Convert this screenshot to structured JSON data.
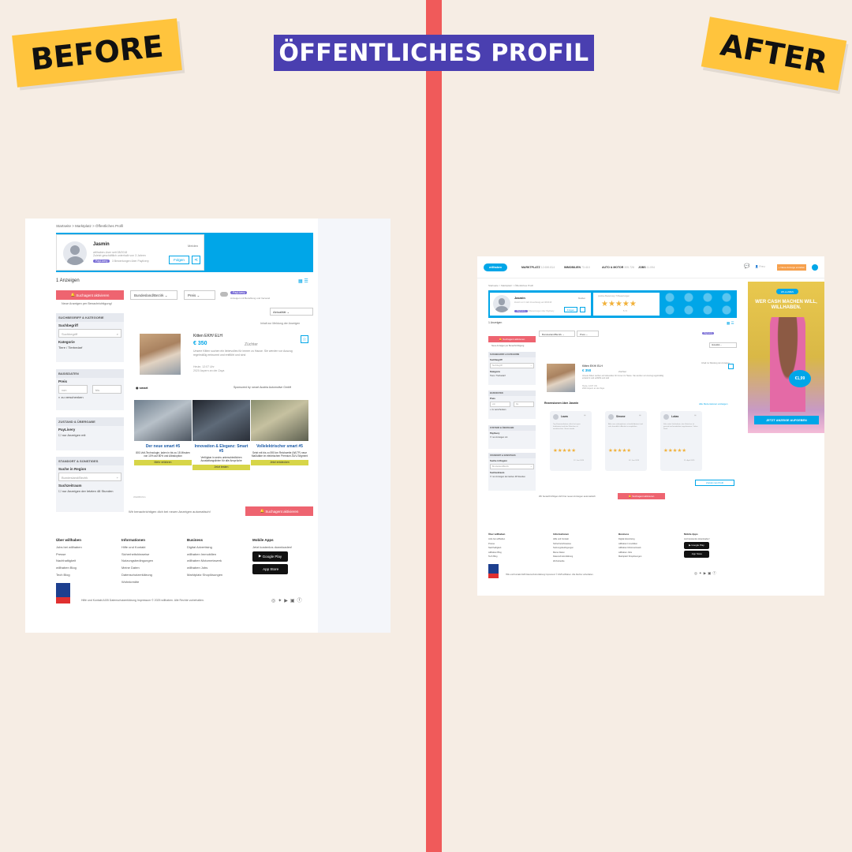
{
  "headline": "ÖFFENTLICHES PROFIL",
  "labels": {
    "before": "BEFORE",
    "after": "AFTER"
  },
  "colors": {
    "background": "#f6ede4",
    "divider": "#f05a5a",
    "title_bg": "#4a3fb0",
    "sticker": "#ffc43d",
    "brand": "#00a6e8",
    "cta_red": "#ee6470",
    "star": "#f1b13a"
  },
  "before": {
    "breadcrumb": "Startseite > Marktplatz > Öffentliches Profil",
    "profile": {
      "name": "Jasmin",
      "since": "willhaben-User seit 08/2018",
      "meta": "Zuletzt geschäftlich unterhalb von 3 Jahren",
      "badge": "PayLivery",
      "verified": "3 Bewertungen über Paylivery",
      "report": "Melden",
      "follow": "Folgen",
      "share_icon": "share-icon"
    },
    "count": "1 Anzeigen",
    "search_agent": "Suchagent aktivieren",
    "search_agent_sub": "Neue Anzeigen per Benachrichtigung!",
    "filters": {
      "region": "Bundesland/Bezirk",
      "price": "Preis",
      "paylivery": "PayLivery",
      "paylivery_sub": "Anzeigen mit Bezahlung und Versand",
      "sort": "Aktualität"
    },
    "sidebar": {
      "search_head": "SUCHBEGRIFF & KATEGORIE",
      "search_label": "Suchbegriff",
      "search_placeholder": "Suchbegriff",
      "category_label": "Kategorie",
      "category_value": "Tiere / Tierbedarf",
      "basis_head": "BASISDATEN",
      "price_label": "Preis",
      "price_from": "von",
      "price_to": "bis",
      "negotiable": "zu verschenken",
      "condition_head": "ZUSTAND & ÜBERGABE",
      "paylivery_label": "PayLivery",
      "paylivery_only": "nur Anzeigen mit",
      "location_head": "STANDORT & SONSTIGES",
      "region_label": "Suche in Region",
      "region_value": "Bundesland/Bezirk",
      "time_label": "Suchzeitraum",
      "time_value": "nur Anzeigen der letzten 48 Stunden"
    },
    "report_hint": "Inhalt zur Meldung der Anzeigen",
    "listing": {
      "title": "Kitten EKH/ ELH",
      "price": "€ 350",
      "tag": "Züchter",
      "desc": "Unsere Kitten suchen ein liebevolles für immer zu Hause. Sie werden vor Auszug regelmäßig entwurmt und entflöht und sind",
      "date": "Heute, 12:07 Uhr",
      "location": "2020 Aspern an der Zaya"
    },
    "ad": {
      "brand": "smart",
      "sponsor": "Sponsored by: smart Austria Automotive GmbH",
      "columns": [
        {
          "title": "Der neue smart #5",
          "text": "800-Volt-Technologie, laden in bis zu 18 Minuten von 10% auf 80% und Allradoption",
          "cta": "Mehr erfahren"
        },
        {
          "title": "Innovation & Eleganz: Smart #5",
          "text": "Verfügbar in sechs unterschiedlichen Ausstattungslinien für alle Ansprüche",
          "cta": "Jetzt testen"
        },
        {
          "title": "Vollelektrischer smart #5",
          "text": "Setzt mit bis zu 590 km Reichweite (WLTP) neue Maßstäbe im elektrischen Premium-SUV-Segment",
          "cta": "Jetzt entdecken"
        }
      ],
      "label": "WERBUNG"
    },
    "bottom_text": "Wir benachrichtigen dich bei neuen Anzeigen automatisch!",
    "bottom_button": "Suchagent aktivieren",
    "footer": {
      "col1": {
        "head": "Über willhaben",
        "items": [
          "Jobs bei willhaben",
          "Presse",
          "Nachhaltigkeit",
          "willhaben Blog",
          "Tech Blog"
        ]
      },
      "col2": {
        "head": "Informationen",
        "items": [
          "Hilfe und Kontakt",
          "Sicherheitshinweise",
          "Nutzungsbedingungen",
          "Meine Daten",
          "Datenschutzerklärung",
          "Wohnkredite"
        ]
      },
      "col3": {
        "head": "Business",
        "items": [
          "Digital Advertising",
          "willhaben Immobilien",
          "willhaben Motornetzwerk",
          "willhaben Jobs",
          "Marktplatz Shoplösungen"
        ]
      },
      "col4": {
        "head": "Mobile Apps",
        "items": [
          "Jetzt kostenlos downloaden!"
        ]
      },
      "google_play": "Google Play",
      "app_store": "App Store",
      "legal": "Hilfe und Kontakt   AGB   Datenschutzerklärung   Impressum   © 2025 willhaben. Alle Rechte vorbehalten."
    }
  },
  "after": {
    "nav": {
      "marktplatz": "MARKTPLATZ",
      "marktplatz_count": "12.659.814",
      "immobilien": "IMMOBILIEN",
      "immobilien_count": "73.410",
      "auto": "AUTO & MOTOR",
      "auto_count": "305.726",
      "jobs": "JOBS",
      "jobs_count": "11.094",
      "user": "Freu",
      "cta": "+ Neue Anzeige erstellen"
    },
    "breadcrumb": "Startseite > Marktplatz > Öffentliches Profil",
    "profile": {
      "name": "Jasmin",
      "sub": "Zuletzt vor 3 Jahr Zuverlässig seit 08/2018",
      "badge": "PayLivery",
      "verified": "3 Bewertungen über Paylivery",
      "report": "Melden",
      "follow": "Folgen"
    },
    "rating": {
      "caption": "positive Bewertung  /  5 Bewertungen",
      "stars": "★★★★★",
      "value": "5 / 5"
    },
    "count": "1 Anzeigen",
    "search_agent": "Suchagent aktivieren",
    "search_agent_sub": "Neue Anzeigen per Benachrichtigung",
    "filters": {
      "region": "Bundesland/Bezirk",
      "price": "Preis",
      "paylivery": "PayLivery",
      "sort": "Aktualität"
    },
    "sidebar": {
      "search_head": "SUCHBEGRIFF & KATEGORIE",
      "search_label": "Suchbegriff",
      "search_placeholder": "Suchbegriff",
      "category_label": "Kategorie",
      "category_value": "Tiere / Tierbedarf",
      "basis_head": "BASISDATEN",
      "price_label": "Preis",
      "price_from": "von",
      "price_to": "bis",
      "negotiable": "zu verschenken",
      "condition_head": "ZUSTAND & ÜBERGABE",
      "paylivery_label": "Paylivery",
      "paylivery_only": "nur Anzeigen mit",
      "location_head": "STANDORT & SONSTIGES",
      "region_label": "Suche in Region",
      "region_value": "Bundesland/Bezirk",
      "time_label": "Suchzeitraum",
      "time_value": "nur Anzeigen der letzten 48 Stunden"
    },
    "listing": {
      "title": "Kitten EKH/ ELH",
      "price": "€ 350",
      "tag": "Züchter",
      "desc": "Unsere Kitten suchen ein liebevolles für immer zu Hause. Sie werden vor Auszug regelmäßig entwurmt und entflöht und sind",
      "date": "Heute, 12:07 Uhr",
      "location": "2020 Aspern an der Zaya",
      "hint": "Inhalt zur Meldung der Anzeigen"
    },
    "reviews_title": "Rezensionen über Jasmin",
    "reviews_all": "Alle Rezensionen anzeigen",
    "reviews": [
      {
        "name": "Laura",
        "text": "Top Kommunikation, alles hat super funktioniert und das Kätzchen ist wunderschön. Gerne wieder",
        "stars": "★★★★★",
        "date": "12. Juni 2025"
      },
      {
        "name": "Simone",
        "text": "Alles war unkompliziert, schnelle Antwort und sehr freundlich. Absolut zu empfehlen",
        "stars": "★★★★★",
        "date": "02. Juni 2025"
      },
      {
        "name": "Lukas",
        "text": "Sehr nette Verkäuferin, das Kätzchen ist gesund und wunderbar angekommen. Vielen Dank",
        "stars": "★★★★★",
        "date": "21. April 2025"
      }
    ],
    "reviews_more": "Zurück zum Profil",
    "bottom_text": "Wir benachrichtigen dich bei neuen Anzeigen automatisch",
    "bottom_button": "Suchagent aktivieren",
    "ad": {
      "pill": "WILLHABEN",
      "headline": "WER CASH MACHEN WILL, WILLHABEN.",
      "price": "€1,99",
      "cta": "JETZT ANZEIGE AUFGEBEN"
    },
    "footer": {
      "col1": {
        "head": "Über willhaben",
        "items": [
          "Jobs bei willhaben",
          "Presse",
          "Nachhaltigkeit",
          "willhaben Blog",
          "Tech Blog"
        ]
      },
      "col2": {
        "head": "Informationen",
        "items": [
          "Hilfe und Kontakt",
          "Sicherheitshinweise",
          "Nutzungsbedingungen",
          "Meine Daten",
          "Datenschutzerklärung",
          "Wohnkredite"
        ]
      },
      "col3": {
        "head": "Business",
        "items": [
          "Digital Advertising",
          "willhaben Immobilien",
          "willhaben Motornetzwerk",
          "willhaben Jobs",
          "Marktplatz Shoplösungen"
        ]
      },
      "col4": {
        "head": "Mobile Apps",
        "items": [
          "Jetzt kostenlos downloaden!"
        ]
      },
      "google_play": "Google Play",
      "app_store": "App Store",
      "legal": "Hilfe und Kontakt   AGB   Datenschutzerklärung   Impressum   © 2025 willhaben. Alle Rechte vorbehalten."
    }
  }
}
